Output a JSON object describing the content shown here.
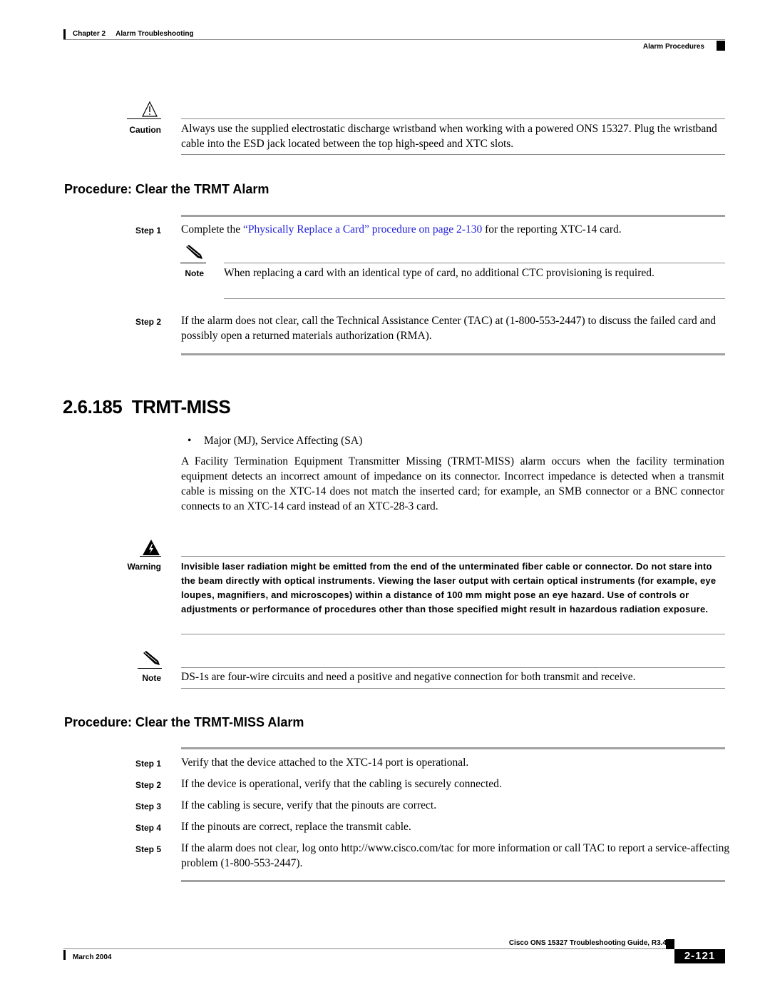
{
  "header": {
    "chapter": "Chapter 2",
    "chapter_title": "Alarm Troubleshooting",
    "section": "Alarm Procedures"
  },
  "caution": {
    "icon": "caution-triangle-icon",
    "label": "Caution",
    "text": "Always use the supplied electrostatic discharge wristband when working with a powered ONS 15327. Plug the wristband cable into the ESD jack located between the top high-speed and XTC slots."
  },
  "procedure_trmt": {
    "title": "Procedure: Clear the TRMT Alarm",
    "steps": [
      {
        "label": "Step 1",
        "text_before": "Complete the ",
        "link_text": "“Physically Replace a Card” procedure on page 2-130",
        "text_after": " for the reporting XTC-14 card."
      },
      {
        "label": "Step 2",
        "text": "If the alarm does not clear, call the Technical Assistance Center (TAC) at (1-800-553-2447) to discuss the failed card and possibly open a returned materials authorization (RMA)."
      }
    ],
    "note": {
      "icon": "pencil-note-icon",
      "label": "Note",
      "text": "When replacing a card with an identical type of card, no additional CTC provisioning is required."
    }
  },
  "section": {
    "number": "2.6.185",
    "title": "TRMT-MISS",
    "severity_bullet": "Major (MJ), Service Affecting (SA)",
    "description": "A Facility Termination Equipment Transmitter Missing (TRMT-MISS) alarm occurs when the facility termination equipment detects an incorrect amount of impedance on its connector. Incorrect impedance is detected when a transmit cable is missing on the XTC-14 does not match the inserted card; for example, an SMB connector or a BNC connector connects to an XTC-14 card instead of an XTC-28-3 card."
  },
  "warning": {
    "icon": "warning-lightning-icon",
    "label": "Warning",
    "text": "Invisible laser radiation might be emitted from the end of the unterminated fiber cable or connector. Do not stare into the beam directly with optical instruments. Viewing the laser output with certain optical instruments (for example, eye loupes, magnifiers, and microscopes) within a distance of 100 mm might pose an eye hazard. Use of controls or adjustments or performance of procedures other than those specified might result in hazardous radiation exposure."
  },
  "note2": {
    "icon": "pencil-note-icon",
    "label": "Note",
    "text": "DS-1s are four-wire circuits and need a positive and negative connection for both transmit and receive."
  },
  "procedure_miss": {
    "title": "Procedure: Clear the TRMT-MISS Alarm",
    "steps": [
      {
        "label": "Step 1",
        "text": "Verify that the device attached to the XTC-14 port is operational."
      },
      {
        "label": "Step 2",
        "text": "If the device is operational, verify that the cabling is securely connected."
      },
      {
        "label": "Step 3",
        "text": "If the cabling is secure, verify that the pinouts are correct."
      },
      {
        "label": "Step 4",
        "text": "If the pinouts are correct, replace the transmit cable."
      },
      {
        "label": "Step 5",
        "text": "If the alarm does not clear, log onto http://www.cisco.com/tac for more information or call TAC to report a service-affecting problem (1-800-553-2447)."
      }
    ]
  },
  "footer": {
    "guide_title": "Cisco ONS 15327 Troubleshooting Guide, R3.4",
    "date": "March 2004",
    "page_number": "2-121"
  }
}
